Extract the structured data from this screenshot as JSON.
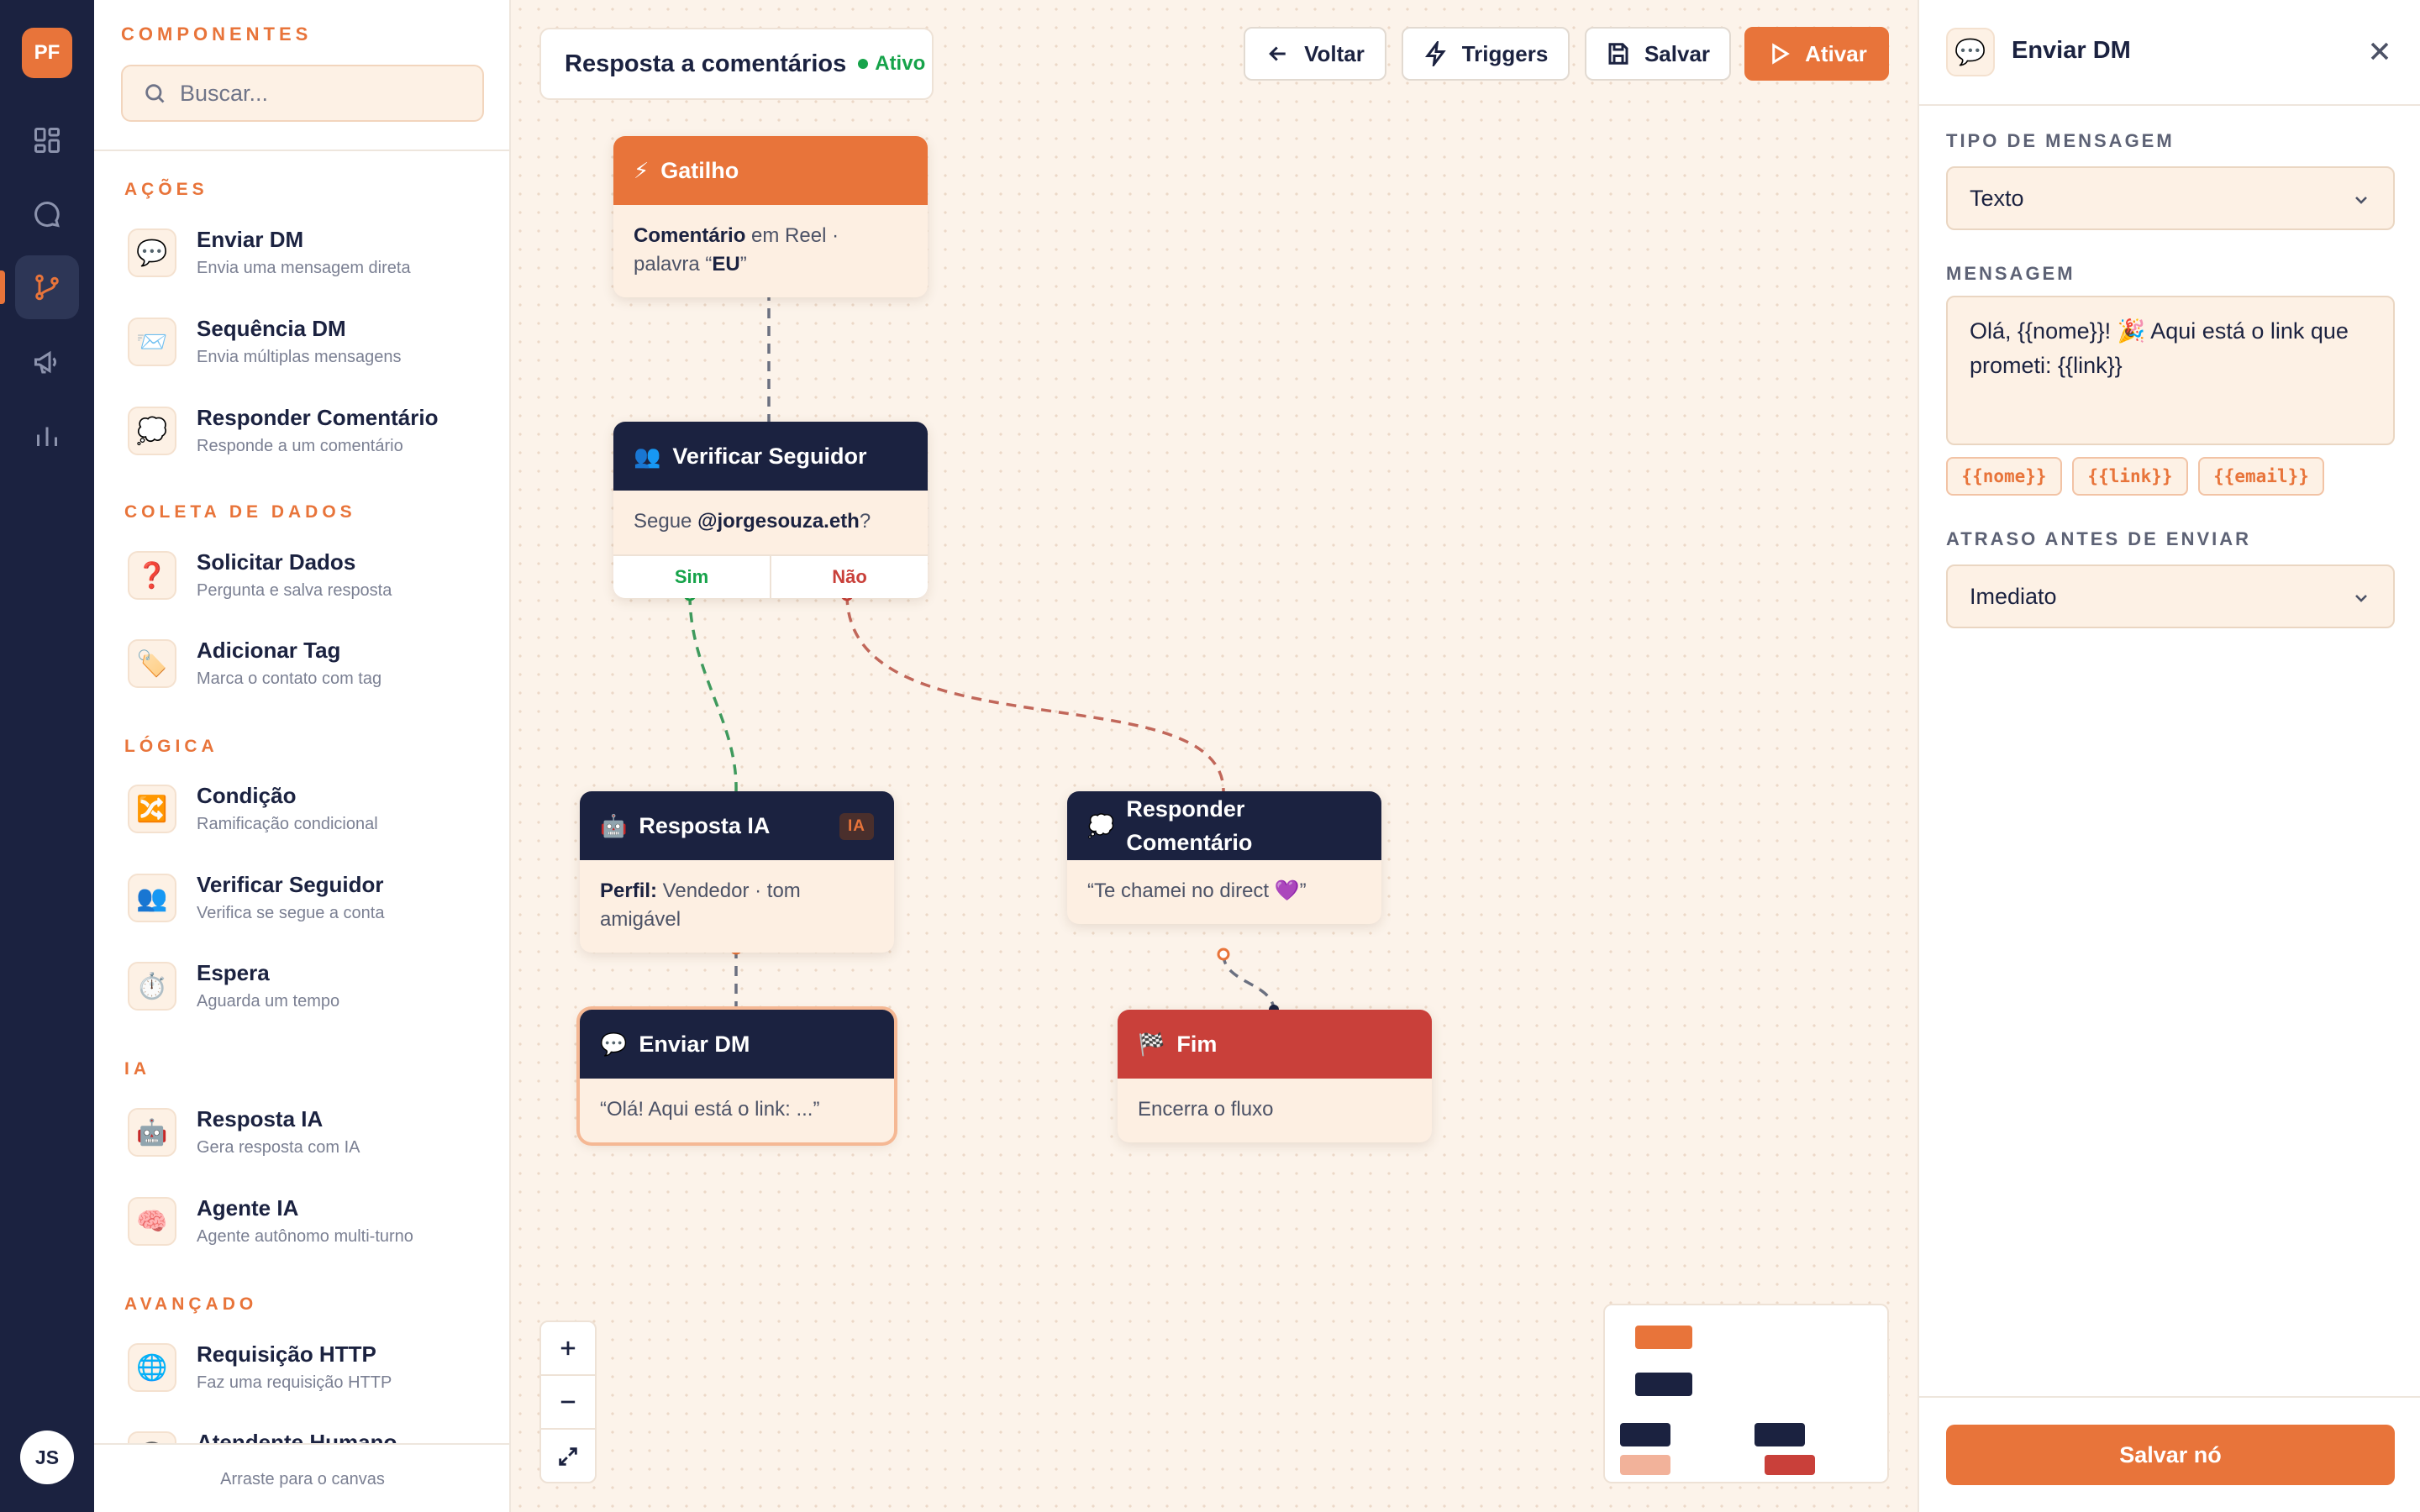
{
  "app": {
    "logo": "PF",
    "user_initials": "JS"
  },
  "rail": {
    "items": [
      {
        "icon": "dashboard-icon"
      },
      {
        "icon": "chat-icon"
      },
      {
        "icon": "flow-branch-icon",
        "active": true
      },
      {
        "icon": "megaphone-icon"
      },
      {
        "icon": "bar-chart-icon"
      }
    ]
  },
  "components": {
    "title": "COMPONENTES",
    "search_placeholder": "Buscar...",
    "sections": [
      {
        "title": "AÇÕES",
        "items": [
          {
            "icon": "speech-balloon-icon",
            "glyph": "💬",
            "name": "Enviar DM",
            "desc": "Envia uma mensagem direta"
          },
          {
            "icon": "envelope-icon",
            "glyph": "📨",
            "name": "Sequência DM",
            "desc": "Envia múltiplas mensagens"
          },
          {
            "icon": "thought-balloon-icon",
            "glyph": "💭",
            "name": "Responder Comentário",
            "desc": "Responde a um comentário"
          }
        ]
      },
      {
        "title": "COLETA DE DADOS",
        "items": [
          {
            "icon": "question-mark-icon",
            "glyph": "❓",
            "name": "Solicitar Dados",
            "desc": "Pergunta e salva resposta"
          },
          {
            "icon": "tag-icon",
            "glyph": "🏷️",
            "name": "Adicionar Tag",
            "desc": "Marca o contato com tag"
          }
        ]
      },
      {
        "title": "LÓGICA",
        "items": [
          {
            "icon": "shuffle-icon",
            "glyph": "🔀",
            "name": "Condição",
            "desc": "Ramificação condicional"
          },
          {
            "icon": "people-icon",
            "glyph": "👥",
            "name": "Verificar Seguidor",
            "desc": "Verifica se segue a conta"
          },
          {
            "icon": "stopwatch-icon",
            "glyph": "⏱️",
            "name": "Espera",
            "desc": "Aguarda um tempo"
          }
        ]
      },
      {
        "title": "IA",
        "items": [
          {
            "icon": "robot-icon",
            "glyph": "🤖",
            "name": "Resposta IA",
            "desc": "Gera resposta com IA"
          },
          {
            "icon": "brain-icon",
            "glyph": "🧠",
            "name": "Agente IA",
            "desc": "Agente autônomo multi-turno"
          }
        ]
      },
      {
        "title": "AVANÇADO",
        "items": [
          {
            "icon": "globe-icon",
            "glyph": "🌐",
            "name": "Requisição HTTP",
            "desc": "Faz uma requisição HTTP"
          },
          {
            "icon": "headset-icon",
            "glyph": "🎧",
            "name": "Atendente Humano",
            "desc": ""
          }
        ]
      }
    ],
    "footer": "Arraste para o canvas"
  },
  "flow": {
    "title": "Resposta a comentários",
    "status": "Ativo",
    "status_color": "#16a34a"
  },
  "toolbar": {
    "back": "Voltar",
    "triggers": "Triggers",
    "save": "Salvar",
    "activate": "Ativar"
  },
  "nodes": {
    "trigger": {
      "icon": "lightning-icon",
      "glyph": "⚡",
      "title": "Gatilho",
      "body_bold1": "Comentário",
      "body_text": " em Reel · palavra “",
      "body_bold2": "EU",
      "body_end": "”"
    },
    "follower": {
      "icon": "people-icon",
      "glyph": "👥",
      "title": "Verificar Seguidor",
      "body_pre": "Segue ",
      "body_bold": "@jorgesouza.eth",
      "body_post": "?",
      "yes": "Sim",
      "no": "Não"
    },
    "ai": {
      "icon": "robot-icon",
      "glyph": "🤖",
      "title": "Resposta IA",
      "badge": "IA",
      "body_bold": "Perfil:",
      "body_text": " Vendedor · tom amigável"
    },
    "reply": {
      "icon": "thought-balloon-icon",
      "glyph": "💭",
      "title": "Responder Comentário",
      "body": "“Te chamei no direct 💜”"
    },
    "dm": {
      "icon": "speech-balloon-icon",
      "glyph": "💬",
      "title": "Enviar DM",
      "body": "“Olá! Aqui está o link: ...”"
    },
    "end": {
      "icon": "checkered-flag-icon",
      "glyph": "🏁",
      "title": "Fim",
      "body": "Encerra o fluxo"
    }
  },
  "colors": {
    "accent": "#e8743a",
    "navy": "#1b2240",
    "end_red": "#c9403a",
    "yes_green": "#16a34a",
    "no_red": "#c9403a"
  },
  "panel": {
    "icon": "speech-balloon-icon",
    "glyph": "💬",
    "title": "Enviar DM",
    "type_label": "TIPO DE MENSAGEM",
    "type_value": "Texto",
    "message_label": "MENSAGEM",
    "message_value": "Olá, {{nome}}! 🎉 Aqui está o link que prometi: {{link}}",
    "variables": [
      "{{nome}}",
      "{{link}}",
      "{{email}}"
    ],
    "delay_label": "ATRASO ANTES DE ENVIAR",
    "delay_value": "Imediato",
    "save_button": "Salvar nó"
  }
}
